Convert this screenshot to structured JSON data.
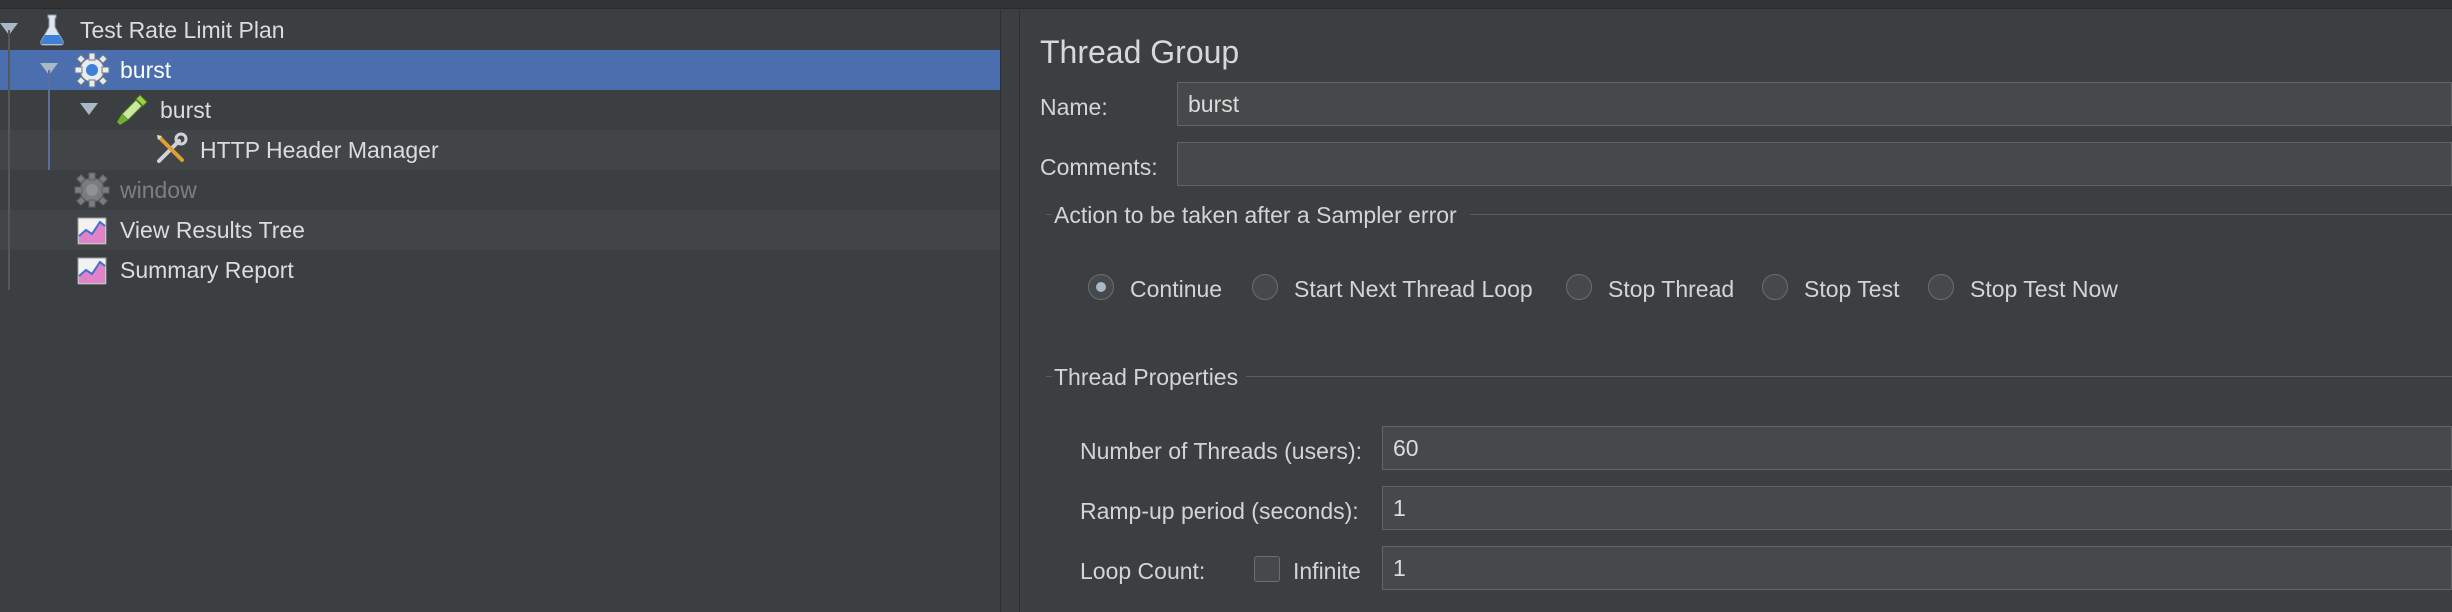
{
  "tree": {
    "items": [
      {
        "label": "Test Rate Limit Plan",
        "icon": "flask-icon",
        "expanded": true
      },
      {
        "label": "burst",
        "icon": "thread-group-gear-icon",
        "expanded": true,
        "selected": true
      },
      {
        "label": "burst",
        "icon": "pipette-sampler-icon",
        "expanded": true
      },
      {
        "label": "HTTP Header Manager",
        "icon": "wrench-screwdriver-icon"
      },
      {
        "label": "window",
        "icon": "thread-group-gear-icon",
        "disabled": true
      },
      {
        "label": "View Results Tree",
        "icon": "chart-listener-icon"
      },
      {
        "label": "Summary Report",
        "icon": "chart-listener-icon"
      }
    ]
  },
  "panel": {
    "title": "Thread Group",
    "name_label": "Name:",
    "name_value": "burst",
    "comments_label": "Comments:",
    "comments_value": "",
    "sampler_error": {
      "title": "Action to be taken after a Sampler error",
      "options": [
        "Continue",
        "Start Next Thread Loop",
        "Stop Thread",
        "Stop Test",
        "Stop Test Now"
      ],
      "selected": "Continue"
    },
    "thread_props": {
      "title": "Thread Properties",
      "threads_label": "Number of Threads (users):",
      "threads_value": "60",
      "rampup_label": "Ramp-up period (seconds):",
      "rampup_value": "1",
      "loop_label": "Loop Count:",
      "infinite_label": "Infinite",
      "infinite_checked": false,
      "loop_value": "1"
    }
  },
  "colors": {
    "background": "#3c3f41",
    "selection": "#4b6eaf",
    "field": "#45494a"
  }
}
